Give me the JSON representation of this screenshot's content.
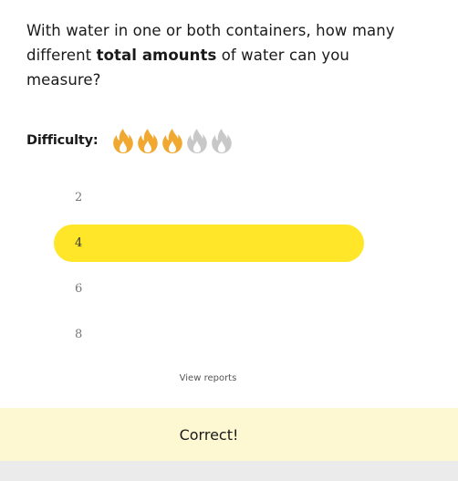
{
  "question": {
    "text_before": "With water in one or both containers, how many different ",
    "bold": "total amounts",
    "text_after": " of water can you measure?"
  },
  "difficulty": {
    "label": "Difficulty:",
    "level": 3,
    "max": 5,
    "active_color": "#f0a830",
    "inactive_color": "#c8c8c8"
  },
  "options": [
    {
      "label": "2",
      "selected": false
    },
    {
      "label": "4",
      "selected": true
    },
    {
      "label": "6",
      "selected": false
    },
    {
      "label": "8",
      "selected": false
    }
  ],
  "view_reports": "View reports",
  "feedback": {
    "text": "Correct!"
  },
  "colors": {
    "selected": "#ffe629",
    "feedback_bg": "#fdf8d2"
  }
}
